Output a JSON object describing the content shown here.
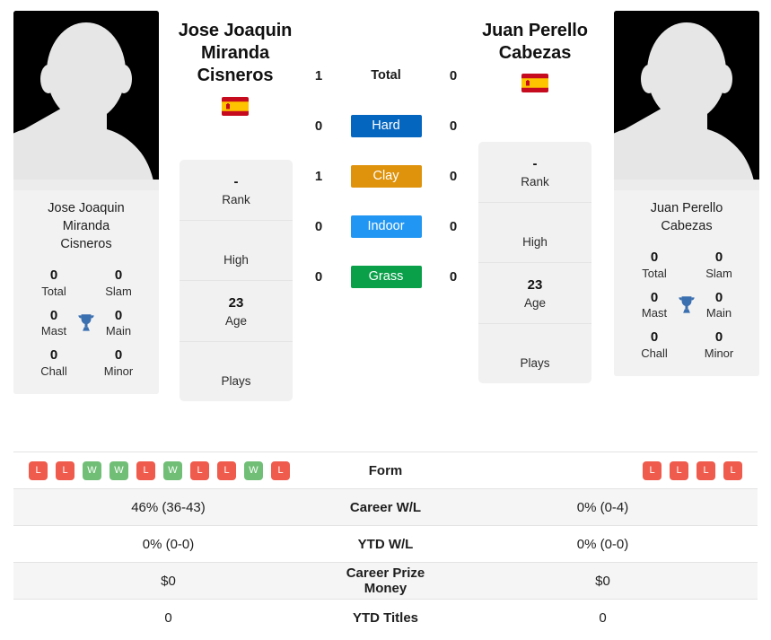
{
  "players": {
    "left": {
      "full_name": "Jose Joaquin Miranda Cisneros",
      "name_line1": "Jose Joaquin",
      "name_line2": "Miranda",
      "name_line3": "Cisneros",
      "photo_name_line1": "Jose Joaquin",
      "photo_name_line2": "Miranda",
      "photo_name_line3": "Cisneros",
      "flag": "spain-flag-icon",
      "flag_alt": "Spain",
      "avatar": "player-avatar-placeholder",
      "info": {
        "rank_value": "-",
        "rank_label": "Rank",
        "high_value": "",
        "high_label": "High",
        "age_value": "23",
        "age_label": "Age",
        "plays_value": "",
        "plays_label": "Plays"
      },
      "titles": {
        "total_value": "0",
        "total_label": "Total",
        "slam_value": "0",
        "slam_label": "Slam",
        "mast_value": "0",
        "mast_label": "Mast",
        "main_value": "0",
        "main_label": "Main",
        "chall_value": "0",
        "chall_label": "Chall",
        "minor_value": "0",
        "minor_label": "Minor",
        "trophy_icon": "trophy-icon"
      },
      "form": [
        "L",
        "L",
        "W",
        "W",
        "L",
        "W",
        "L",
        "L",
        "W",
        "L"
      ],
      "career_wl": "46% (36-43)",
      "ytd_wl": "0% (0-0)",
      "career_prize_money": "$0",
      "ytd_titles": "0"
    },
    "right": {
      "full_name": "Juan Perello Cabezas",
      "name_line1": "Juan Perello",
      "name_line2": "Cabezas",
      "name_line3": "",
      "photo_name_line1": "Juan Perello",
      "photo_name_line2": "Cabezas",
      "photo_name_line3": "",
      "flag": "spain-flag-icon",
      "flag_alt": "Spain",
      "avatar": "player-avatar-placeholder",
      "info": {
        "rank_value": "-",
        "rank_label": "Rank",
        "high_value": "",
        "high_label": "High",
        "age_value": "23",
        "age_label": "Age",
        "plays_value": "",
        "plays_label": "Plays"
      },
      "titles": {
        "total_value": "0",
        "total_label": "Total",
        "slam_value": "0",
        "slam_label": "Slam",
        "mast_value": "0",
        "mast_label": "Mast",
        "main_value": "0",
        "main_label": "Main",
        "chall_value": "0",
        "chall_label": "Chall",
        "minor_value": "0",
        "minor_label": "Minor",
        "trophy_icon": "trophy-icon"
      },
      "form": [
        "L",
        "L",
        "L",
        "L"
      ],
      "career_wl": "0% (0-4)",
      "ytd_wl": "0% (0-0)",
      "career_prize_money": "$0",
      "ytd_titles": "0"
    }
  },
  "head_to_head": {
    "rows": [
      {
        "left": "1",
        "label": "Total",
        "right": "0",
        "color": "",
        "plain": true
      },
      {
        "left": "0",
        "label": "Hard",
        "right": "0",
        "color": "#0566c0",
        "plain": false
      },
      {
        "left": "1",
        "label": "Clay",
        "right": "0",
        "color": "#df930c",
        "plain": false
      },
      {
        "left": "0",
        "label": "Indoor",
        "right": "0",
        "color": "#2196f3",
        "plain": false
      },
      {
        "left": "0",
        "label": "Grass",
        "right": "0",
        "color": "#0aa04a",
        "plain": false
      }
    ]
  },
  "stats_table": {
    "rows": [
      {
        "label": "Form",
        "type": "form"
      },
      {
        "label": "Career W/L",
        "type": "text",
        "key": "career_wl"
      },
      {
        "label": "YTD W/L",
        "type": "text",
        "key": "ytd_wl"
      },
      {
        "label": "Career Prize Money",
        "type": "text",
        "key": "career_prize_money"
      },
      {
        "label": "YTD Titles",
        "type": "text",
        "key": "ytd_titles"
      }
    ]
  },
  "colors": {
    "win_badge": "#ef5b4c",
    "loss_badge": "#ef5b4c",
    "win": "#71bf77",
    "loss": "#ef5b4c",
    "trophy": "#3a6fb0",
    "card_bg": "#f1f1f1",
    "row_shade": "#f5f5f5"
  }
}
